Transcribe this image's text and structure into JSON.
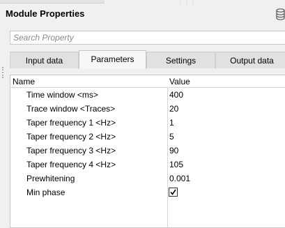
{
  "panel": {
    "title": "Module Properties",
    "icon": "database-icon"
  },
  "search": {
    "placeholder": "Search Property"
  },
  "tabs": [
    {
      "label": "Input data",
      "active": false
    },
    {
      "label": "Parameters",
      "active": true
    },
    {
      "label": "Settings",
      "active": false
    },
    {
      "label": "Output data",
      "active": false
    }
  ],
  "grid": {
    "columns": {
      "name": "Name",
      "value": "Value"
    },
    "rows": [
      {
        "name": "Time window <ms>",
        "value": "400"
      },
      {
        "name": "Trace window <Traces>",
        "value": "20"
      },
      {
        "name": "Taper frequency 1 <Hz>",
        "value": "1"
      },
      {
        "name": "Taper frequency 2 <Hz>",
        "value": "5"
      },
      {
        "name": "Taper frequency 3 <Hz>",
        "value": "90"
      },
      {
        "name": "Taper frequency 4 <Hz>",
        "value": "105"
      },
      {
        "name": "Prewhitening",
        "value": "0.001"
      },
      {
        "name": "Min phase",
        "checked": true
      }
    ]
  }
}
